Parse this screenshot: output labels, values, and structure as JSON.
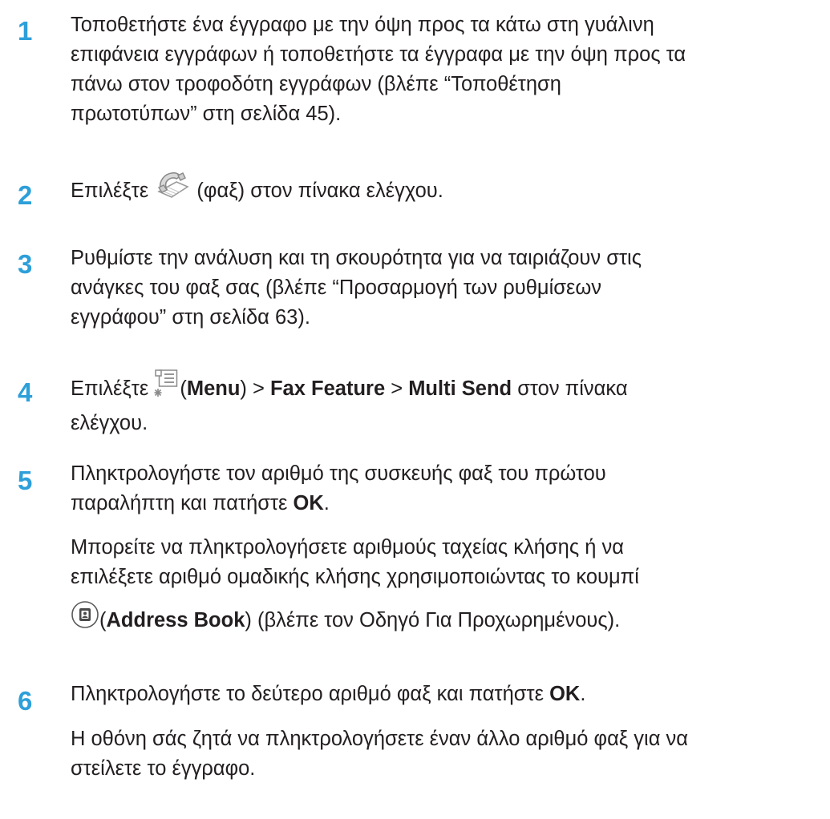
{
  "steps": [
    {
      "number": "1",
      "lines": [
        "Τοποθετήστε ένα έγγραφο με την όψη προς τα κάτω στη γυάλινη",
        "επιφάνεια εγγράφων ή τοποθετήστε τα έγγραφα με την όψη προς τα",
        "πάνω στον τροφοδότη εγγράφων (βλέπε “Τοποθέτηση",
        "πρωτοτύπων” στη σελίδα 45)."
      ]
    },
    {
      "number": "2",
      "before_icon": "Επιλέξτε ",
      "icon": "fax-icon",
      "after_icon": " (φαξ) στον πίνακα ελέγχου."
    },
    {
      "number": "3",
      "lines": [
        "Ρυθμίστε την ανάλυση και τη σκουρότητα για να ταιριάζουν στις",
        "ανάγκες του φαξ σας (βλέπε “Προσαρμογή των ρυθμίσεων",
        "εγγράφου” στη σελίδα 63)."
      ]
    },
    {
      "number": "4",
      "before_icon": "Επιλέξτε ",
      "icon": "menu-icon",
      "paren_open": "(",
      "menu": "Menu",
      "sep1": ") > ",
      "fax_feature": "Fax Feature",
      "sep2": " > ",
      "multi_send": "Multi Send",
      "tail": " στον πίνακα",
      "line2": "ελέγχου."
    },
    {
      "number": "5",
      "line1": "Πληκτρολογήστε τον αριθμό της συσκευής φαξ του πρώτου",
      "line2_pre": "παραλήπτη και πατήστε ",
      "line2_bold": "OK",
      "line2_post": ".",
      "sub_line1": "Μπορείτε να πληκτρολογήσετε αριθμούς ταχείας κλήσης ή να",
      "sub_line2": "επιλέξετε αριθμό ομαδικής κλήσης χρησιμοποιώντας το κουμπί",
      "icon": "address-book-icon",
      "sub_line3_open": "(",
      "address_book": "Address Book",
      "sub_line3_post": ") (βλέπε τον Οδηγό Για Προχωρημένους)."
    },
    {
      "number": "6",
      "line1_pre": "Πληκτρολογήστε το δεύτερο αριθμό φαξ και πατήστε ",
      "line1_bold": "OK",
      "line1_post": ".",
      "sub_line1": "Η οθόνη σάς ζητά να πληκτρολογήσετε έναν άλλο αριθμό φαξ για να",
      "sub_line2": "στείλετε το έγγραφο."
    }
  ],
  "colors": {
    "step_number": "#2d9fd9",
    "text": "#231f20"
  }
}
